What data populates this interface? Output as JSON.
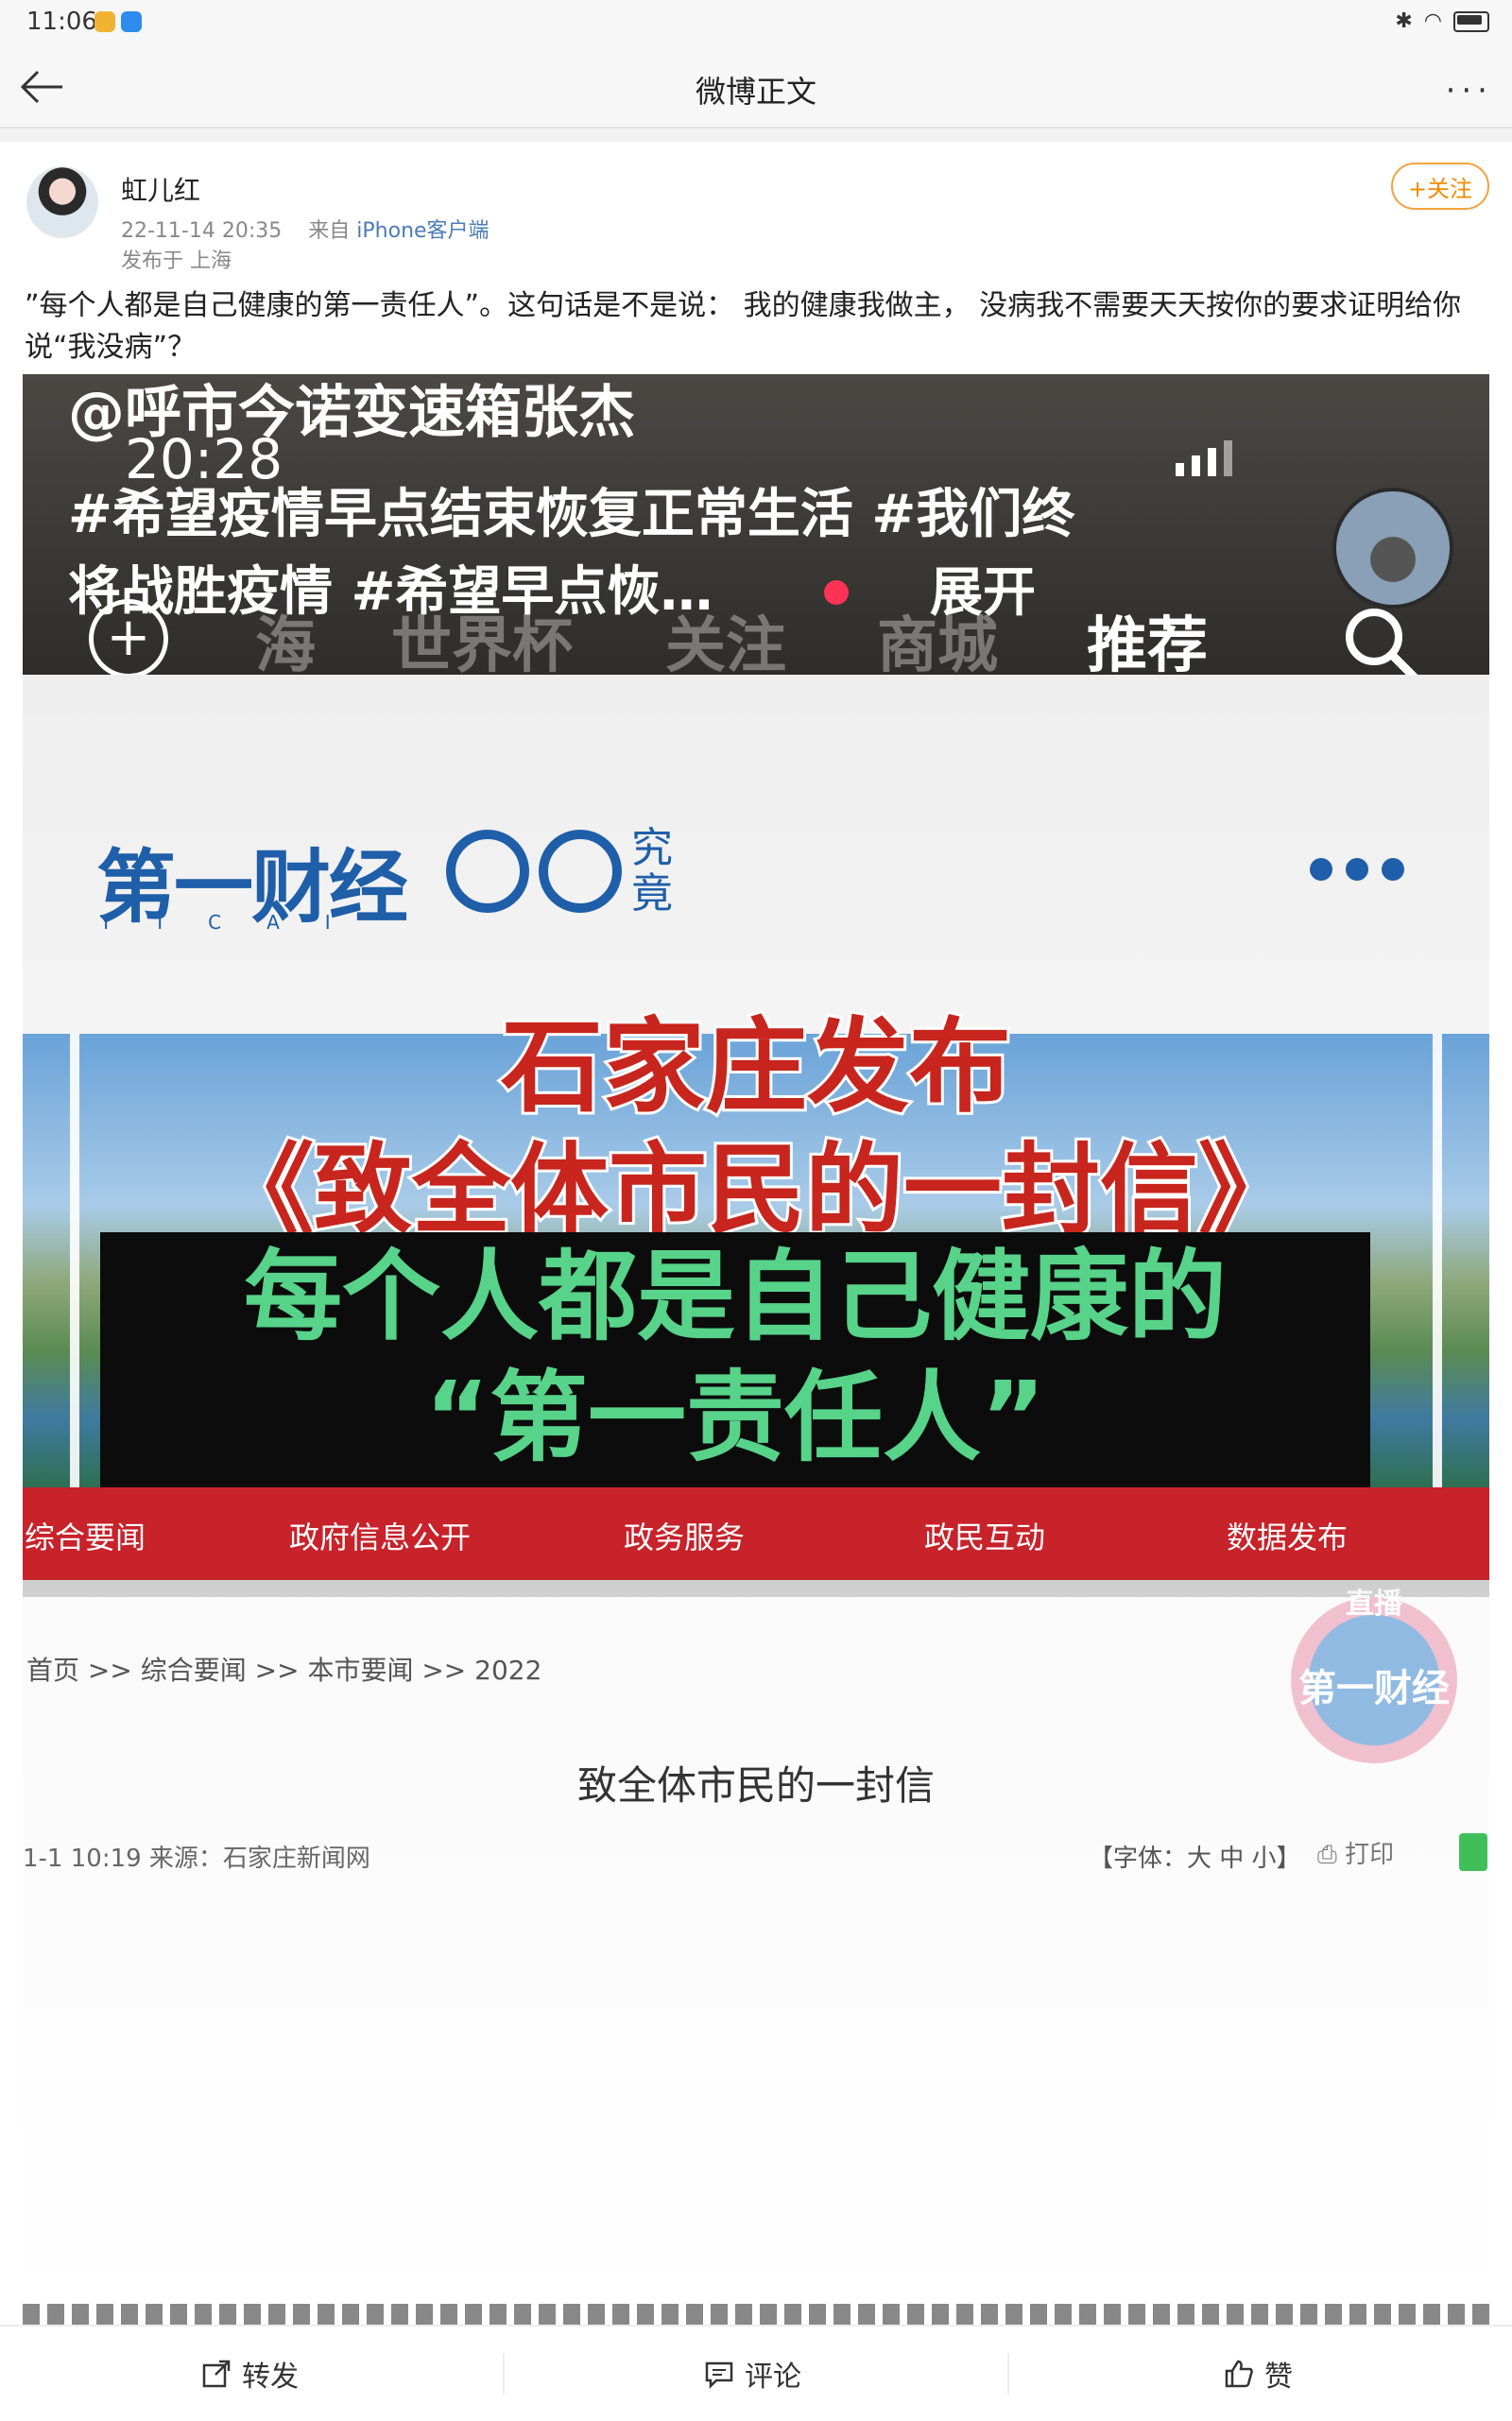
{
  "status_bar": {
    "time": "11:06"
  },
  "nav": {
    "title": "微博正文"
  },
  "post": {
    "username": "虹儿红",
    "timestamp": "22-11-14 20:35",
    "source_prefix": "来自",
    "source_client": "iPhone客户端",
    "location": "发布于 上海",
    "follow_label": "+关注",
    "text": "”每个人都是自己健康的第一责任人”。这句话是不是说： 我的健康我做主， 没病我不需要天天按你的要求证明给你说“我没病”？"
  },
  "media": {
    "overlay_handle": "@呼市今诺变速箱张杰",
    "overlay_clock": "20:28",
    "overlay_tags": "#希望疫情早点结束恢复正常生活 #我们终将战胜疫情 #希望早点恢…",
    "overlay_expand": "展开",
    "tabs": [
      "海",
      "世界杯",
      "关注",
      "商城",
      "推荐"
    ],
    "brand": "第一财经",
    "brand_sub": "YICAI",
    "brand2": "究竟",
    "headline_1": "石家庄发布",
    "headline_2": "《致全体市民的一封信》",
    "headline_3_line1": "每个人都是自己健康的",
    "headline_3_line2": "“第一责任人”",
    "gov_menu": [
      "综合要闻",
      "政府信息公开",
      "政务服务",
      "政民互动",
      "数据发布"
    ],
    "live_label": "直播",
    "live_brand": "第一财经",
    "breadcrumb": "首页 >> 综合要闻 >> 本市要闻 >> 2022",
    "letter_title": "致全体市民的一封信",
    "doc_meta": "1-1  10:19  来源：石家庄新闻网",
    "doc_font": "【字体：大 中 小】",
    "doc_print": "打印"
  },
  "actions": {
    "repost": "转发",
    "comment": "评论",
    "like": "赞"
  }
}
